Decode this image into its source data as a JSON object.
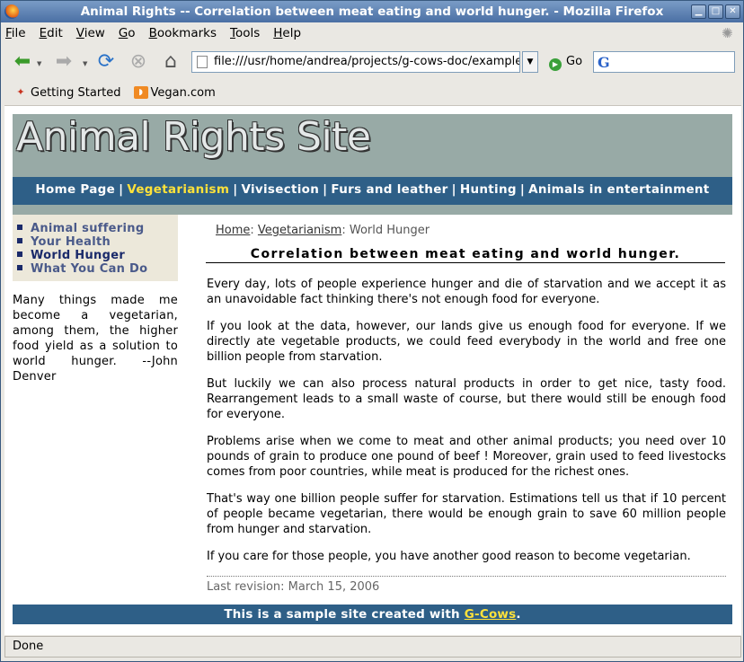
{
  "window": {
    "title": "Animal Rights -- Correlation between meat eating and world hunger. - Mozilla Firefox"
  },
  "menu": [
    "File",
    "Edit",
    "View",
    "Go",
    "Bookmarks",
    "Tools",
    "Help"
  ],
  "toolbar": {
    "url": "file:///usr/home/andrea/projects/g-cows-doc/example",
    "go_label": "Go",
    "search_logo": "G"
  },
  "bookmarks": [
    {
      "label": "Getting Started",
      "icon": "firefox-bookmark-icon"
    },
    {
      "label": "Vegan.com",
      "icon": "rss-feed-icon"
    }
  ],
  "site": {
    "title": "Animal Rights Site",
    "nav": [
      {
        "label": "Home Page",
        "current": false
      },
      {
        "label": "Vegetarianism",
        "current": true
      },
      {
        "label": "Vivisection",
        "current": false
      },
      {
        "label": "Furs and leather",
        "current": false
      },
      {
        "label": "Hunting",
        "current": false
      },
      {
        "label": "Animals in entertainment",
        "current": false
      }
    ],
    "nav_sep": "|",
    "side_menu": [
      {
        "label": "Animal suffering",
        "current": false
      },
      {
        "label": "Your Health",
        "current": false
      },
      {
        "label": "World Hunger",
        "current": true
      },
      {
        "label": "What You Can Do",
        "current": false
      }
    ],
    "quote": "Many things made me become a vegetarian, among them, the higher food yield as a solution to world hunger. --John Denver",
    "breadcrumb": {
      "home": "Home",
      "sep": ":",
      "section": "Vegetarianism",
      "current": "World Hunger"
    },
    "page_title": "Correlation between meat eating and world hunger.",
    "paragraphs": [
      "Every day, lots of people experience hunger and die of starvation and we accept it as an unavoidable fact thinking there's not enough food for everyone.",
      "If you look at the data, however, our lands give us enough food for everyone. If we directly ate vegetable products, we could feed everybody in the world and free one billion people from starvation.",
      "But luckily we can also process natural products in order to get nice, tasty food. Rearrangement leads to a small waste of course, but there would still be enough food for everyone.",
      "Problems arise when we come to meat and other animal products; you need over 10 pounds of grain to produce one pound of beef ! Moreover, grain used to feed livestocks comes from poor countries, while meat is produced for the richest ones.",
      "That's way one billion people suffer for starvation. Estimations tell us that if 10 percent of people became vegetarian, there would be enough grain to save 60 million people from hunger and starvation.",
      "If you care for those people, you have another good reason to become vegetarian."
    ],
    "last_revision": "Last revision: March 15, 2006",
    "footer": {
      "text_before": "This is a sample site created with ",
      "link": "G-Cows",
      "text_after": "."
    }
  },
  "status": "Done",
  "colors": {
    "nav_bg": "#2e5f87",
    "header_bg": "#98aaa6",
    "highlight": "#ffe23a",
    "side_bg": "#ece8da"
  }
}
